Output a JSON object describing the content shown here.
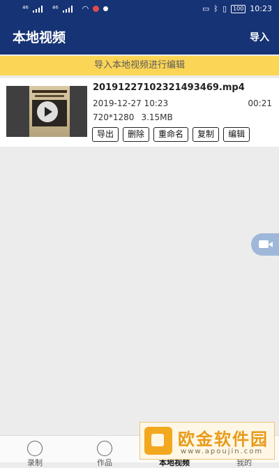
{
  "status": {
    "left_signal1": "⁴⁶",
    "left_signal2": "⁴⁶",
    "time": "10:23",
    "battery": "100"
  },
  "appbar": {
    "title": "本地视频",
    "import_label": "导入"
  },
  "banner": {
    "text": "导入本地视频进行编辑"
  },
  "video": {
    "filename": "20191227102321493469.mp4",
    "date": "2019-12-27 10:23",
    "duration": "00:21",
    "resolution": "720*1280",
    "size": "3.15MB",
    "actions": [
      "导出",
      "删除",
      "重命名",
      "复制",
      "编辑"
    ]
  },
  "nav": {
    "items": [
      "录制",
      "作品",
      "本地视频",
      "我的"
    ]
  },
  "watermark": {
    "brand": "欧金软件园",
    "url": "www.apoujin.com"
  },
  "colors": {
    "primary": "#163375",
    "banner": "#fbd556"
  }
}
